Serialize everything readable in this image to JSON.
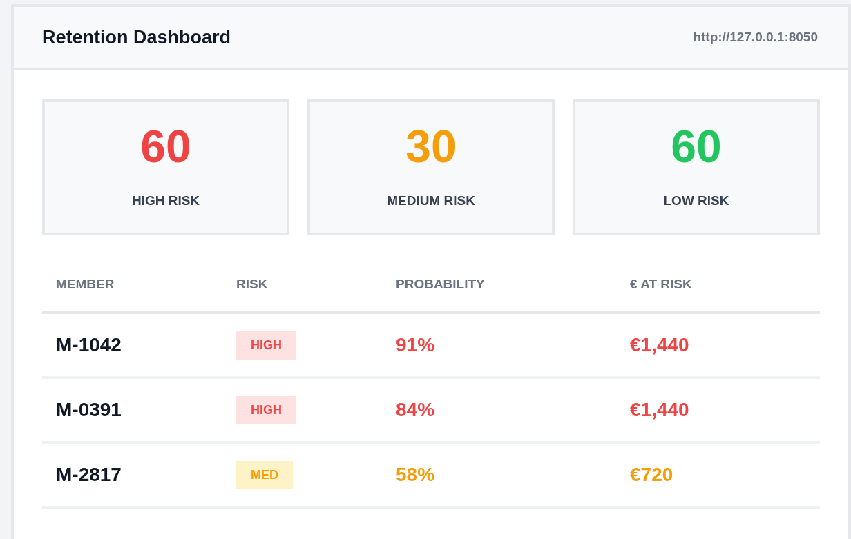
{
  "header": {
    "title": "Retention Dashboard",
    "url": "http://127.0.0.1:8050"
  },
  "cards": [
    {
      "kind": "high",
      "value": "60",
      "label": "HIGH RISK"
    },
    {
      "kind": "medium",
      "value": "30",
      "label": "MEDIUM RISK"
    },
    {
      "kind": "low",
      "value": "60",
      "label": "LOW RISK"
    }
  ],
  "table": {
    "columns": [
      "MEMBER",
      "RISK",
      "PROBABILITY",
      "€ AT RISK"
    ],
    "rows": [
      {
        "kind": "high",
        "member": "M-1042",
        "risk": "HIGH",
        "probability": "91%",
        "at_risk": "€1,440"
      },
      {
        "kind": "high",
        "member": "M-0391",
        "risk": "HIGH",
        "probability": "84%",
        "at_risk": "€1,440"
      },
      {
        "kind": "medium",
        "member": "M-2817",
        "risk": "MED",
        "probability": "58%",
        "at_risk": "€720"
      }
    ]
  }
}
